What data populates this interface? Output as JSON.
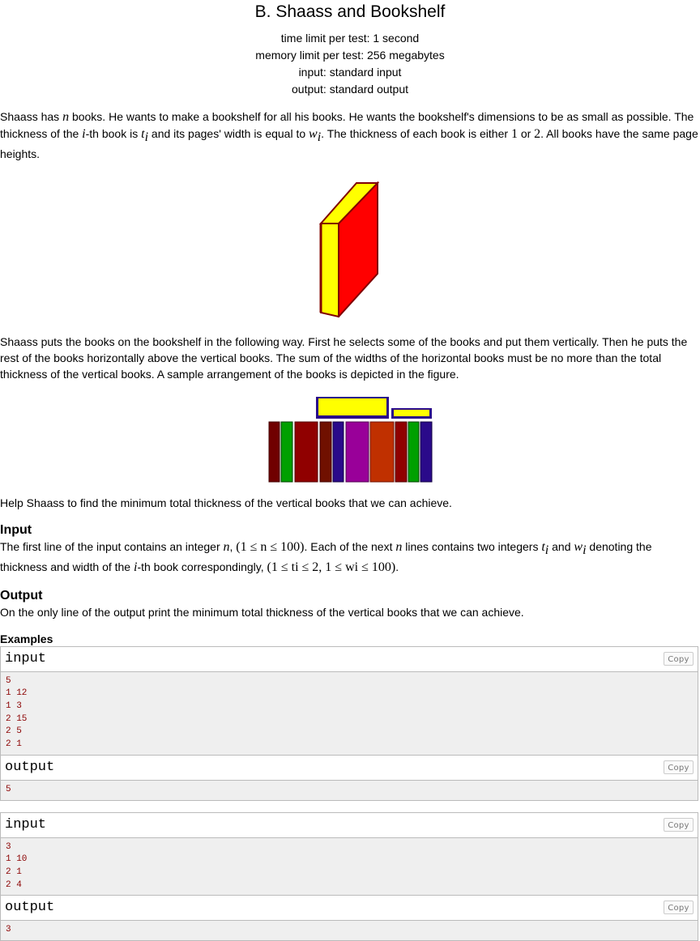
{
  "problem": {
    "title": "B. Shaass and Bookshelf",
    "time_limit": "time limit per test: 1 second",
    "memory_limit": "memory limit per test: 256 megabytes",
    "input_spec": "input: standard input",
    "output_spec": "output: standard output"
  },
  "statement": {
    "p1_a": "Shaass has ",
    "p1_n": "n",
    "p1_b": " books. He wants to make a bookshelf for all his books. He wants the bookshelf's dimensions to be as small as possible. The thickness of the ",
    "p1_i": "i",
    "p1_c": "-th book is ",
    "p1_t": "t",
    "p1_ti": "i",
    "p1_d": " and its pages' width is equal to ",
    "p1_w": "w",
    "p1_wi": "i",
    "p1_e": ". The thickness of each book is either ",
    "p1_one": "1",
    "p1_or": " or ",
    "p1_two": "2",
    "p1_f": ". All books have the same page heights.",
    "p2": "Shaass puts the books on the bookshelf in the following way. First he selects some of the books and put them vertically. Then he puts the rest of the books horizontally above the vertical books. The sum of the widths of the horizontal books must be no more than the total thickness of the vertical books. A sample arrangement of the books is depicted in the figure.",
    "p3": "Help Shaass to find the minimum total thickness of the vertical books that we can achieve."
  },
  "input_section": {
    "title": "Input",
    "a": "The first line of the input contains an integer ",
    "n": "n",
    "b": ", ",
    "constraint1": "(1 ≤ n ≤ 100)",
    "c": ". Each of the next ",
    "n2": "n",
    "d": " lines contains two integers ",
    "t": "t",
    "ti": "i",
    "e": " and ",
    "w": "w",
    "wi": "i",
    "f": " denoting the thickness and width of the ",
    "i": "i",
    "g": "-th book correspondingly, ",
    "constraint2": "(1 ≤ ti ≤ 2, 1 ≤ wi ≤ 100)",
    "h": "."
  },
  "output_section": {
    "title": "Output",
    "text": "On the only line of the output print the minimum total thickness of the vertical books that we can achieve."
  },
  "examples": {
    "title": "Examples",
    "input_label": "input",
    "output_label": "output",
    "copy_label": "Copy",
    "samples": [
      {
        "input": "5\n1 12\n1 3\n2 15\n2 5\n2 1",
        "output": "5"
      },
      {
        "input": "3\n1 10\n2 1\n2 4",
        "output": "3"
      }
    ]
  },
  "colors": {
    "book_red": "#ff0000",
    "book_yellow": "#ffff00",
    "book_maroon": "#800000",
    "book_green": "#00a000",
    "book_navy": "#2a0a8a",
    "book_purple": "#990099",
    "book_orange": "#c03000"
  },
  "icons": {
    "figure1": "single-book-figure",
    "figure2": "bookshelf-arrangement-figure"
  }
}
